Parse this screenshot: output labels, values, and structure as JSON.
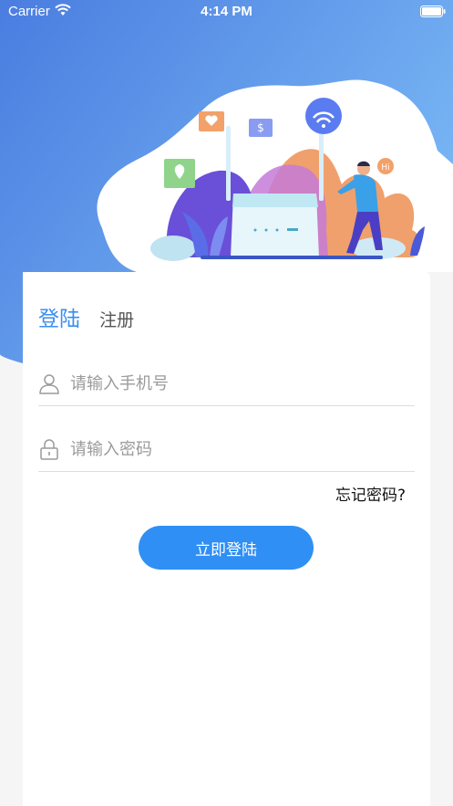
{
  "status_bar": {
    "carrier": "Carrier",
    "time": "4:14 PM"
  },
  "tabs": {
    "login_label": "登陆",
    "register_label": "注册"
  },
  "form": {
    "phone_placeholder": "请输入手机号",
    "password_placeholder": "请输入密码",
    "forgot_label": "忘记密码?",
    "submit_label": "立即登陆"
  },
  "illustration": {
    "bubble_text": "Hi",
    "price_tag": "$"
  },
  "icons": {
    "wifi": "wifi-icon",
    "battery": "battery-icon",
    "user": "user-icon",
    "lock": "lock-icon"
  },
  "colors": {
    "primary": "#2f8ff5",
    "header_gradient_start": "#4a7fe0",
    "header_gradient_end": "#7ab6f5"
  }
}
